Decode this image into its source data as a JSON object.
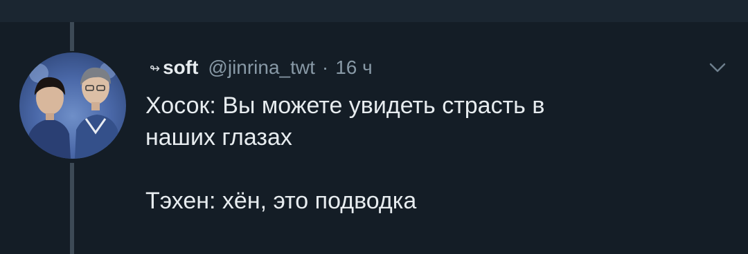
{
  "tweet": {
    "name_icon": "↬",
    "display_name": "soft",
    "handle": "@jinrina_twt",
    "separator": "·",
    "time": "16 ч",
    "lines": [
      "Хосок: Вы можете увидеть страсть в",
      "наших глазах",
      "",
      "Тэхен: хён, это подводка"
    ]
  },
  "icons": {
    "name_icon": "link-arrow-icon",
    "menu": "chevron-down-icon"
  },
  "colors": {
    "background": "#141d26",
    "top_strip": "#1b2631",
    "thread_line": "#3d4a56",
    "text_primary": "#e7ecef",
    "text_secondary": "#8899a6"
  }
}
